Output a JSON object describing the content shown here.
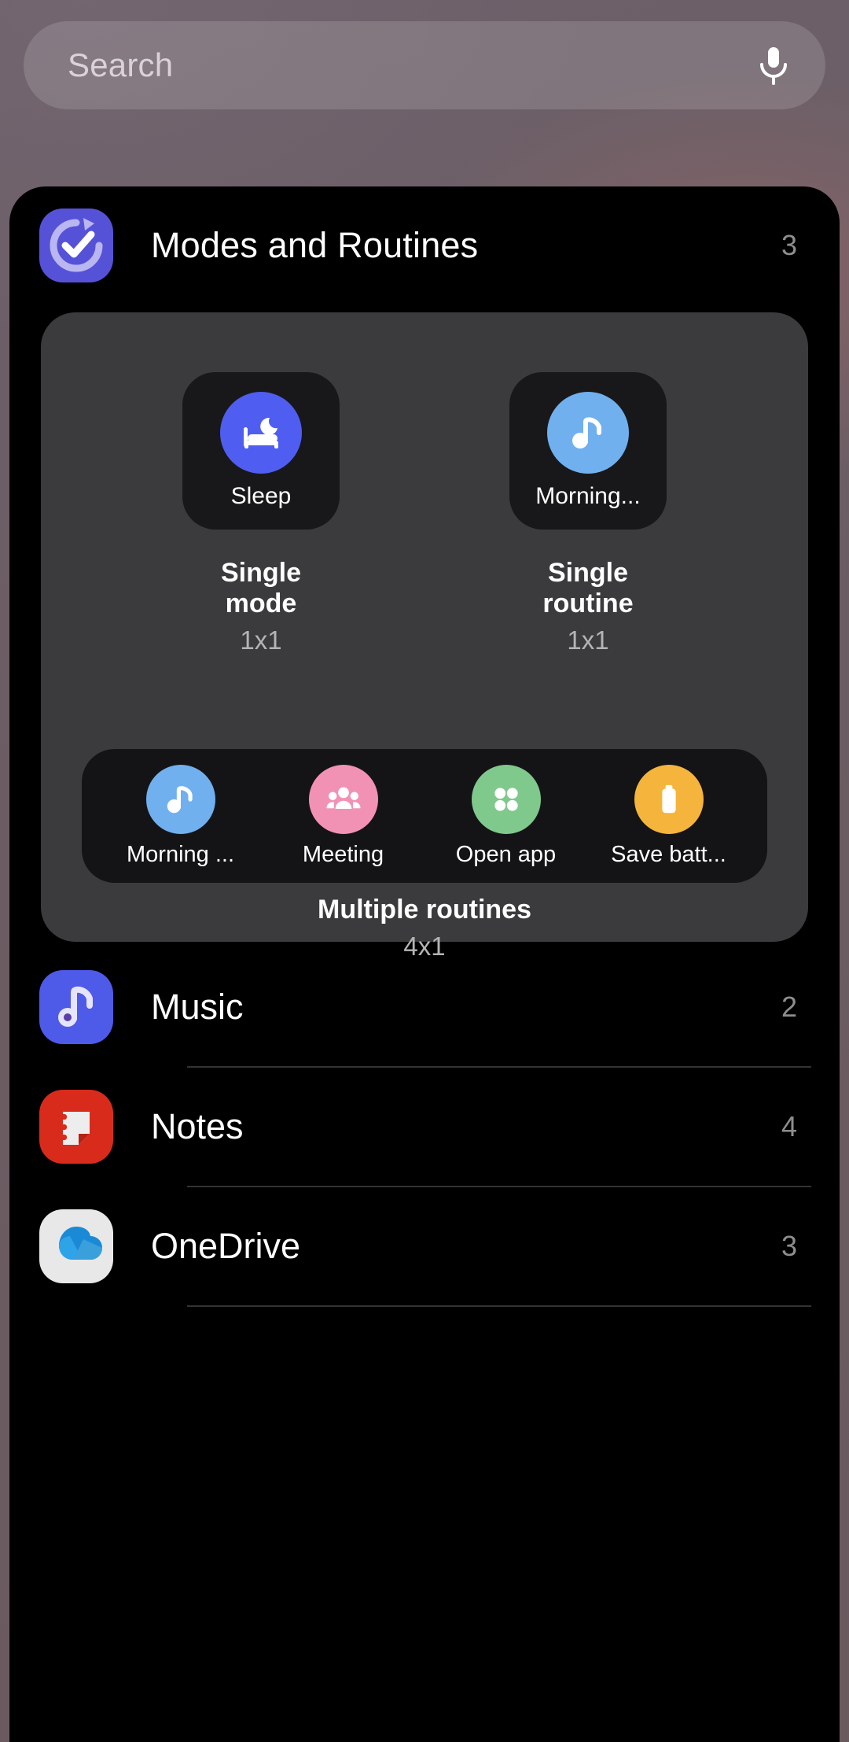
{
  "search": {
    "placeholder": "Search",
    "mic_icon": "microphone-icon"
  },
  "header": {
    "icon": "modes-and-routines-icon",
    "title": "Modes and Routines",
    "count": "3",
    "icon_color": "#5552d8"
  },
  "widget_preview": {
    "single_widgets": [
      {
        "tile_label": "Sleep",
        "icon": "bed-moon-icon",
        "icon_color": "#4f5ef0",
        "name": "Single mode",
        "size": "1x1"
      },
      {
        "tile_label": "Morning...",
        "icon": "music-note-icon",
        "icon_color": "#71b0ef",
        "name": "Single routine",
        "size": "1x1"
      }
    ],
    "multi_widget": {
      "items": [
        {
          "label": "Morning ...",
          "icon": "music-note-icon",
          "icon_color": "#71b0ef"
        },
        {
          "label": "Meeting",
          "icon": "people-group-icon",
          "icon_color": "#f192b4"
        },
        {
          "label": "Open app",
          "icon": "four-dots-icon",
          "icon_color": "#7fc98c"
        },
        {
          "label": "Save batt...",
          "icon": "battery-icon",
          "icon_color": "#f5b43c"
        }
      ],
      "name": "Multiple routines",
      "size": "4x1"
    }
  },
  "app_list": [
    {
      "title": "Music",
      "count": "2",
      "icon": "samsung-music-icon",
      "icon_color": "#4e5ae8"
    },
    {
      "title": "Notes",
      "count": "4",
      "icon": "samsung-notes-icon",
      "icon_color": "#d92b1c"
    },
    {
      "title": "OneDrive",
      "count": "3",
      "icon": "onedrive-icon",
      "icon_color": "#e8e8e8"
    }
  ]
}
